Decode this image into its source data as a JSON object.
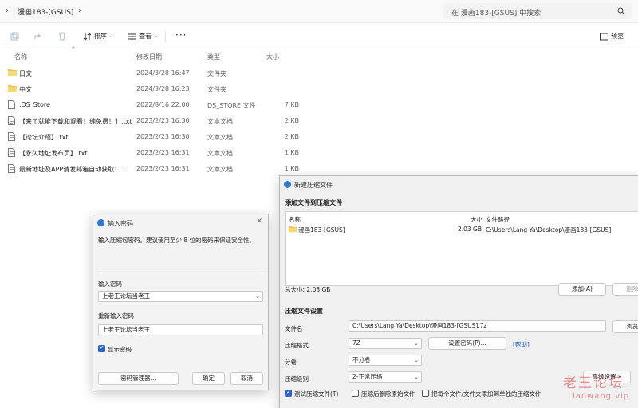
{
  "address_bar": {
    "path": "漫画183-[GSUS]",
    "search_placeholder": "在 漫画183-[GSUS] 中搜索"
  },
  "toolbar": {
    "sort_label": "排序",
    "view_label": "查看",
    "more_label": "···",
    "preview_label": "预览"
  },
  "columns": {
    "name": "名称",
    "date": "修改日期",
    "type": "类型",
    "size": "大小"
  },
  "files": [
    {
      "icon": "folder-icon",
      "name": "日文",
      "date": "2024/3/28 16:47",
      "type": "文件夹",
      "size": ""
    },
    {
      "icon": "folder-icon",
      "name": "中文",
      "date": "2024/3/28 16:23",
      "type": "文件夹",
      "size": ""
    },
    {
      "icon": "file-icon",
      "name": ".DS_Store",
      "date": "2022/8/16 22:00",
      "type": "DS_STORE 文件",
      "size": "7 KB"
    },
    {
      "icon": "text-file-icon",
      "name": "【来了就能下载和观看！纯免费！】.txt",
      "date": "2023/2/23 16:30",
      "type": "文本文档",
      "size": "2 KB"
    },
    {
      "icon": "text-file-icon",
      "name": "【论坛介绍】.txt",
      "date": "2023/2/23 16:30",
      "type": "文本文档",
      "size": "2 KB"
    },
    {
      "icon": "text-file-icon",
      "name": "【永久地址发布页】.txt",
      "date": "2023/2/23 16:31",
      "type": "文本文档",
      "size": "1 KB"
    },
    {
      "icon": "text-file-icon",
      "name": "最新地址及APP请发邮箱自动获取！...",
      "date": "2023/2/23 16:31",
      "type": "文本文档",
      "size": "1 KB"
    }
  ],
  "password_dialog": {
    "title": "输入密码",
    "instruction": "输入压缩包密码。建议使用至少 8 位的密码来保证安全性。",
    "password_label": "输入密码",
    "password_value": "上老王论坛当老王",
    "confirm_label": "重新输入密码",
    "confirm_value": "上老王论坛当老王",
    "show_password_label": "显示密码",
    "manager_button": "密码管理器...",
    "ok_button": "确定",
    "cancel_button": "取消"
  },
  "compress_dialog": {
    "title": "新建压缩文件",
    "add_section": "添加文件到压缩文件",
    "list_headers": {
      "name": "名称",
      "size": "大小",
      "path": "文件路径"
    },
    "list_rows": [
      {
        "name": "漫画183-[GSUS]",
        "size": "2.03 GB",
        "path": "C:\\Users\\Lang Ya\\Desktop\\漫画183-[GSUS]"
      }
    ],
    "total_size": "总大小: 2.03 GB",
    "add_button": "添加(A)",
    "delete_button": "删除",
    "settings_section": "压缩文件设置",
    "filename_label": "文件名",
    "filename_value": "C:\\Users\\Lang Ya\\Desktop\\漫画183-[GSUS].7z",
    "browse_button": "浏览",
    "format_label": "压缩格式",
    "format_value": "7Z",
    "set_password_button": "设置密码(P)...",
    "help_link": "[帮助]",
    "split_label": "分卷",
    "split_value": "不分卷",
    "level_label": "压缩级别",
    "level_value": "2-正常压缩",
    "advanced_button": "高级设置 »",
    "test_label": "测试压缩文件(T)",
    "delete_after_label": "压缩后删除原始文件",
    "separate_label": "把每个文件/文件夹添加到单独的压缩文件"
  },
  "watermark": {
    "line1": "老王论坛",
    "line2": "laowang.vip"
  },
  "colors": {
    "accent": "#2b63c6",
    "folder": "#f2c14e",
    "link": "#1a55c4",
    "watermark": "#d63c3c"
  }
}
